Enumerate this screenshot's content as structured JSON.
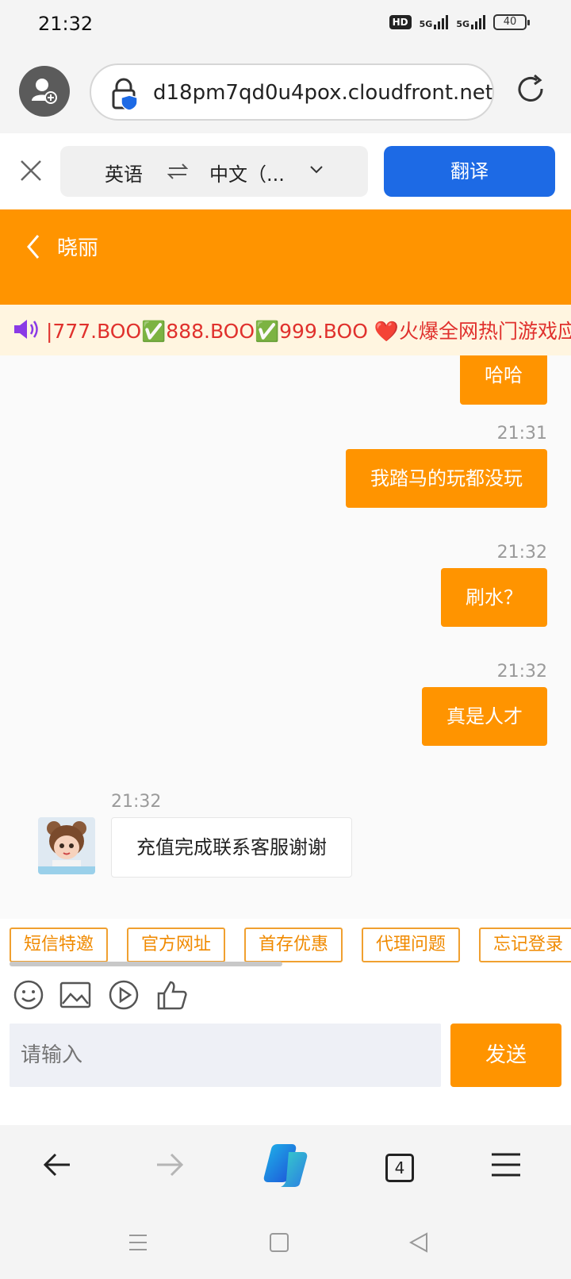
{
  "status_bar": {
    "time": "21:32",
    "hd": "HD",
    "net1": "5G",
    "net2": "5G",
    "battery": "40"
  },
  "browser": {
    "url": "d18pm7qd0u4pox.cloudfront.net/",
    "tab_count": "4"
  },
  "translate": {
    "source_lang": "英语",
    "target_lang": "中文（...",
    "translate_button": "翻译"
  },
  "chat": {
    "title": "晓丽",
    "announcement": "|777.BOO✅888.BOO✅999.BOO ❤️火爆全网热门游戏应",
    "messages": [
      {
        "side": "right",
        "time": "",
        "text": "哈哈"
      },
      {
        "side": "right",
        "time": "21:31",
        "text": "我踏马的玩都没玩"
      },
      {
        "side": "right",
        "time": "21:32",
        "text": "刷水？"
      },
      {
        "side": "right",
        "time": "21:32",
        "text": "真是人才"
      },
      {
        "side": "left",
        "time": "21:32",
        "text": "充值完成联系客服谢谢"
      }
    ]
  },
  "quick_replies": [
    "短信特邀",
    "官方网址",
    "首存优惠",
    "代理问题",
    "忘记登录"
  ],
  "toolbar_icons": [
    "emoji-icon",
    "image-icon",
    "video-icon",
    "thumbs-up-icon"
  ],
  "composer": {
    "placeholder": "请输入",
    "send_label": "发送"
  },
  "colors": {
    "accent": "#ff9400",
    "translate_blue": "#1d6ae5",
    "marquee_text": "#e0312d"
  }
}
